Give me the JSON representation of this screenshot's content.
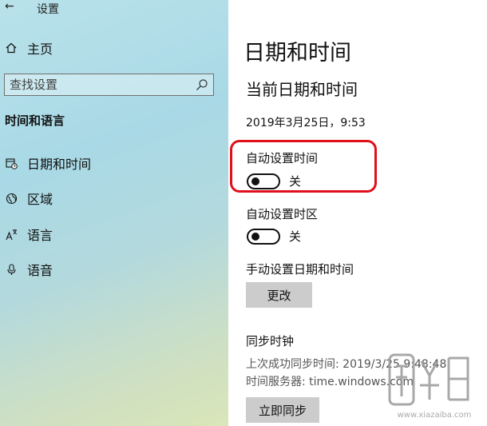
{
  "titlebar": {
    "back_glyph": "←",
    "title": "设置"
  },
  "sidebar": {
    "home_label": "主页",
    "search_placeholder": "查找设置",
    "section_title": "时间和语言",
    "items": [
      {
        "label": "日期和时间",
        "icon": "calendar-clock-icon"
      },
      {
        "label": "区域",
        "icon": "globe-icon"
      },
      {
        "label": "语言",
        "icon": "language-icon"
      },
      {
        "label": "语音",
        "icon": "microphone-icon"
      }
    ]
  },
  "main": {
    "title": "日期和时间",
    "subtitle": "当前日期和时间",
    "current_datetime": "2019年3月25日，9:53",
    "auto_time": {
      "label": "自动设置时间",
      "state": "关"
    },
    "auto_timezone": {
      "label": "自动设置时区",
      "state": "关"
    },
    "manual": {
      "label": "手动设置日期和时间",
      "button": "更改"
    },
    "sync": {
      "title": "同步时钟",
      "last_sync": "上次成功同步时间: 2019/3/25 9:48:48",
      "server": "时间服务器: time.windows.com",
      "button": "立即同步"
    }
  },
  "colors": {
    "highlight": "#e0101a",
    "button_bg": "#cccccc"
  },
  "watermark": {
    "text": "下载吧",
    "subtext": "www.xiazaiba.com"
  }
}
